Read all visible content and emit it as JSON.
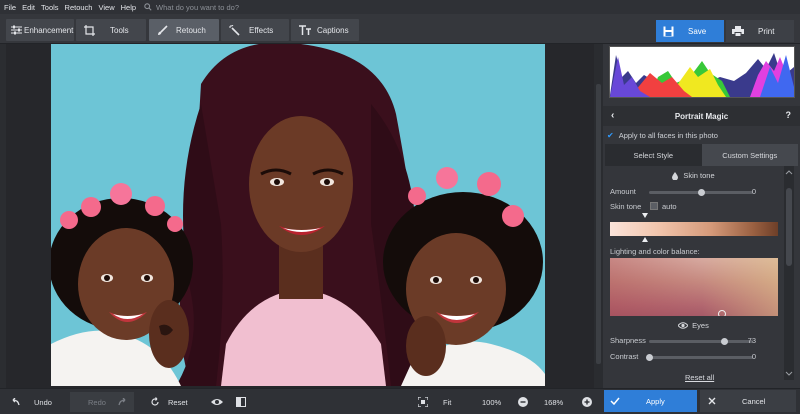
{
  "menu": {
    "items": [
      "File",
      "Edit",
      "Tools",
      "Retouch",
      "View",
      "Help"
    ],
    "search_placeholder": "What do you want to do?"
  },
  "toolbar": {
    "enhancement": "Enhancement",
    "tools": "Tools",
    "retouch": "Retouch",
    "effects": "Effects",
    "captions": "Captions",
    "save": "Save",
    "print": "Print",
    "active_tab": "Retouch"
  },
  "panel": {
    "title": "Portrait Magic",
    "help": "?",
    "apply_all": "Apply to all faces in this photo",
    "tabs": [
      "Select Style",
      "Custom Settings"
    ],
    "active_tab": "Custom Settings",
    "skin_tone_section": "Skin tone",
    "amount_label": "Amount",
    "amount_value": "0",
    "amount_level": 0.5,
    "skin_tone_label": "Skin tone",
    "auto_label": "auto",
    "lighting_label": "Lighting and color balance:",
    "eyes_section": "Eyes",
    "sharpness_label": "Sharpness",
    "sharpness_value": "73",
    "sharpness_level": 0.73,
    "contrast_label": "Contrast",
    "contrast_value": "0",
    "contrast_level": 0.0,
    "reset_all": "Reset all"
  },
  "bottom": {
    "undo": "Undo",
    "redo": "Redo",
    "reset": "Reset",
    "fit": "Fit",
    "zoom_100": "100%",
    "zoom_value": "168%",
    "apply": "Apply",
    "cancel": "Cancel"
  },
  "colors": {
    "accent": "#2f7ed8",
    "background": "#2b2d31",
    "panel": "#34363b"
  }
}
